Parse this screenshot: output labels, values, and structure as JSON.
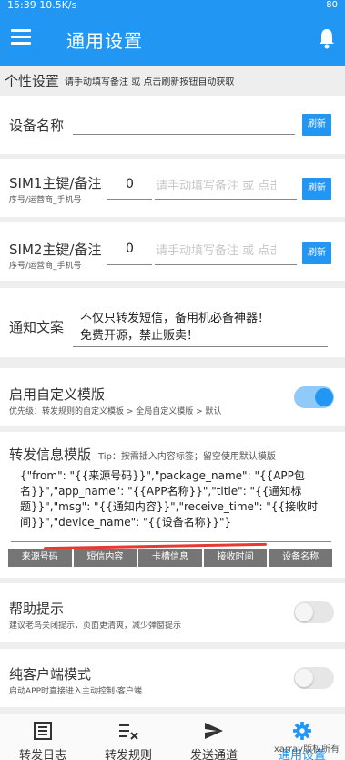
{
  "status_bar": {
    "time": "15:39",
    "speed": "10.5K/s",
    "battery": "80"
  },
  "toolbar": {
    "title": "通用设置"
  },
  "section": {
    "title": "个性设置",
    "hint": "请手动填写备注 或 点击刷新按钮自动获取"
  },
  "device_name": {
    "label": "设备名称",
    "value": "",
    "refresh": "刷新"
  },
  "sim1": {
    "label": "SIM1主键/备注",
    "sub": "序号/运营商_手机号",
    "index": "0",
    "placeholder": "请手动填写备注 或 点击刷新",
    "refresh": "刷新"
  },
  "sim2": {
    "label": "SIM2主键/备注",
    "sub": "序号/运营商_手机号",
    "index": "0",
    "placeholder": "请手动填写备注 或 点击刷新",
    "refresh": "刷新"
  },
  "notice": {
    "label": "通知文案",
    "line1": "不仅只转发短信，备用机必备神器！",
    "line2": "免费开源，禁止贩卖！"
  },
  "custom_template": {
    "label": "启用自定义模版",
    "sub": "优先级：转发规则的自定义模板 > 全局自定义模版 > 默认",
    "enabled": true
  },
  "template": {
    "label": "转发信息模版",
    "tip": "Tip：按需插入内容标签；留空使用默认模版",
    "content": "{\"from\": \"{{来源号码}}\",\"package_name\": \"{{APP包名}}\",\"app_name\": \"{{APP名称}}\",\"title\": \"{{通知标题}}\",\"msg\": \"{{通知内容}}\",\"receive_time\": \"{{接收时间}}\",\"device_name\": \"{{设备名称}}\"}",
    "tags": [
      "来源号码",
      "短信内容",
      "卡槽信息",
      "接收时间",
      "设备名称"
    ]
  },
  "help": {
    "label": "帮助提示",
    "sub": "建议老鸟关闭提示，页面更清爽，减少弹窗提示",
    "enabled": false
  },
  "pure_client": {
    "label": "纯客户端模式",
    "sub": "启动APP时直接进入主动控制·客户端",
    "enabled": false
  },
  "nav": {
    "items": [
      {
        "label": "转发日志",
        "icon": "log-list-icon",
        "active": false
      },
      {
        "label": "转发规则",
        "icon": "rules-icon",
        "active": false
      },
      {
        "label": "发送通道",
        "icon": "send-icon",
        "active": false
      },
      {
        "label": "通用设置",
        "icon": "gear-icon",
        "active": true
      }
    ]
  },
  "watermark": "xarray版权所有",
  "colors": {
    "primary": "#2196f3",
    "tag": "#757575",
    "annotation": "#e53935"
  }
}
